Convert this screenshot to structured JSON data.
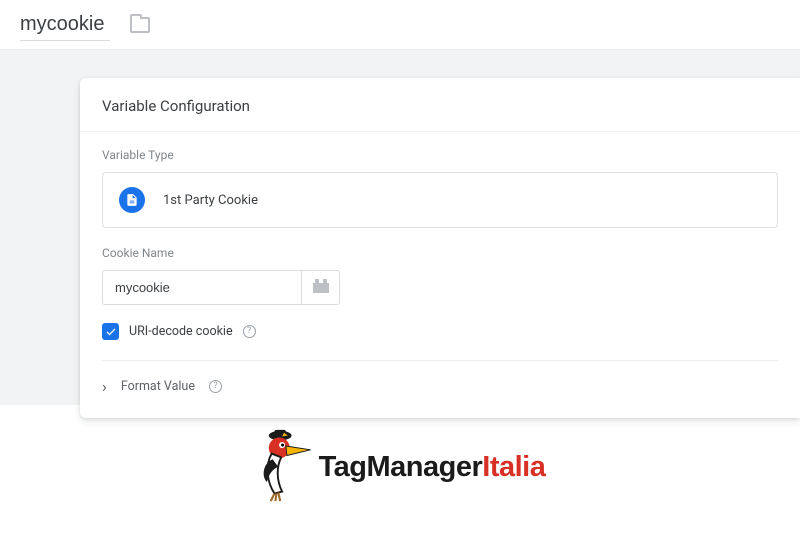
{
  "header": {
    "variable_name": "mycookie"
  },
  "card": {
    "title": "Variable Configuration",
    "type_section_label": "Variable Type",
    "type_name": "1st Party Cookie",
    "cookie_section_label": "Cookie Name",
    "cookie_value": "mycookie",
    "uri_decode_label": "URI-decode cookie",
    "uri_decode_checked": true,
    "format_value_label": "Format Value"
  },
  "footer": {
    "brand_part1": "TagManager",
    "brand_part2": "Italia"
  }
}
